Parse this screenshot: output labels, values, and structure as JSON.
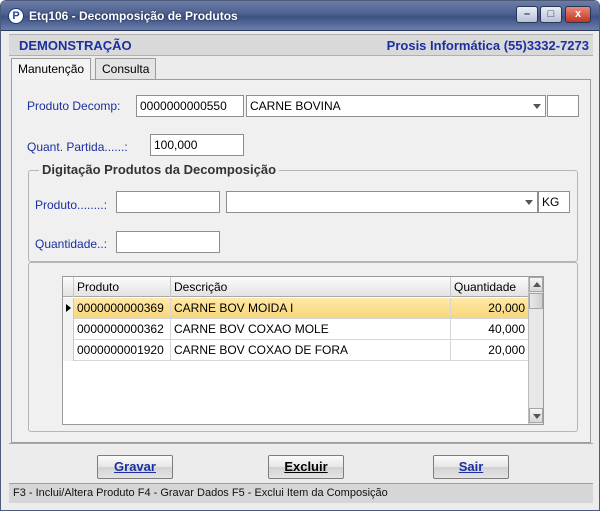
{
  "window": {
    "title": "Etq106 - Decomposição de Produtos",
    "icon_letter": "P",
    "controls": {
      "minimize": "–",
      "maximize": "□",
      "close": "x"
    }
  },
  "header": {
    "left": "DEMONSTRAÇÃO",
    "right": "Prosis Informática (55)3332-7273"
  },
  "tabs": [
    {
      "label": "Manutenção",
      "active": true
    },
    {
      "label": "Consulta",
      "active": false
    }
  ],
  "form": {
    "produto_decomp": {
      "label": "Produto Decomp:",
      "code": "0000000000550",
      "description": "CARNE BOVINA",
      "extra": ""
    },
    "quant_partida": {
      "label": "Quant. Partida......:",
      "value": "100,000"
    }
  },
  "group": {
    "title": "Digitação Produtos da Decomposição",
    "produto": {
      "label": "Produto........:",
      "code": "",
      "description": "",
      "unit": "KG"
    },
    "quantidade": {
      "label": "Quantidade..:",
      "value": ""
    }
  },
  "grid": {
    "columns": [
      "Produto",
      "Descrição",
      "Quantidade"
    ],
    "rows": [
      {
        "produto": "0000000000369",
        "descricao": "CARNE BOV MOIDA I",
        "quantidade": "20,000",
        "selected": true
      },
      {
        "produto": "0000000000362",
        "descricao": "CARNE BOV COXAO MOLE",
        "quantidade": "40,000",
        "selected": false
      },
      {
        "produto": "0000000001920",
        "descricao": "CARNE BOV COXAO DE FORA",
        "quantidade": "20,000",
        "selected": false
      }
    ]
  },
  "buttons": {
    "gravar": "Gravar",
    "excluir": "Excluir",
    "sair": "Sair"
  },
  "status_text": "F3 - Inclui/Altera Produto   F4 - Gravar Dados   F5 - Exclui Item da Composição",
  "colors": {
    "accent_text": "#1b2fa0",
    "selected_row": "#f7d77a"
  }
}
